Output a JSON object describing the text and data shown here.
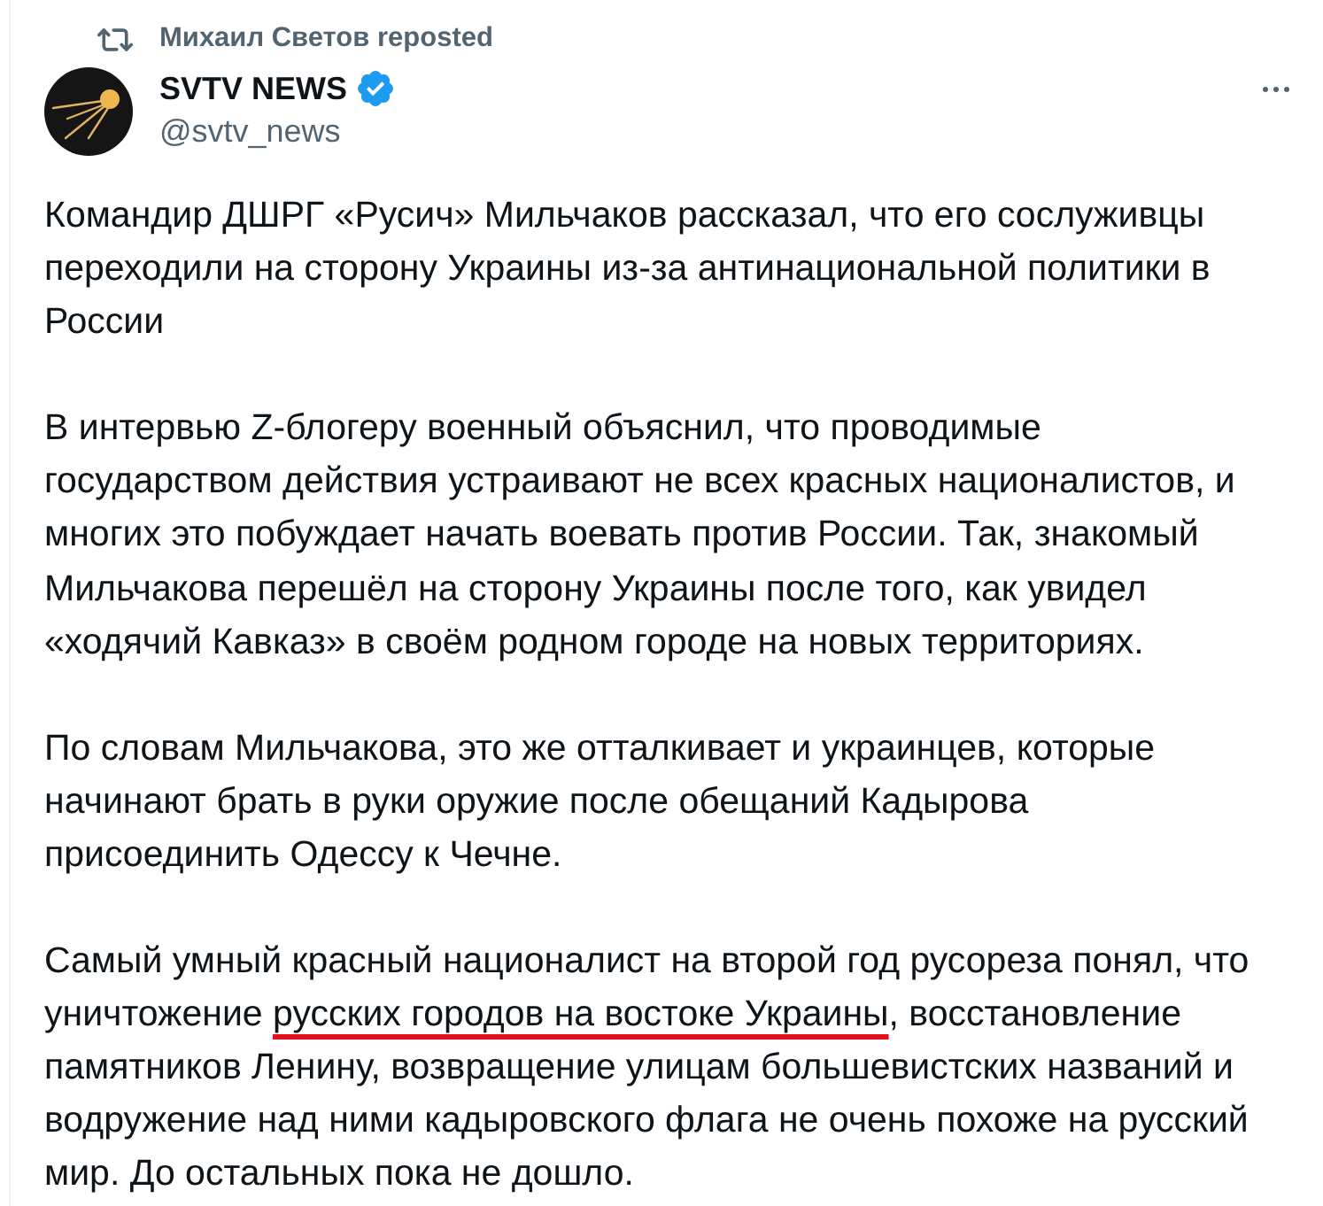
{
  "repost": {
    "text": "Михаил Светов reposted"
  },
  "author": {
    "name": "SVTV NEWS",
    "verified": true,
    "handle": "@svtv_news"
  },
  "paragraphs": [
    {
      "segments": [
        {
          "kind": "plain",
          "text": "Командир ДШРГ «Русич» Мильчаков рассказал, что его сослуживцы\nпереходили на сторону Украины из-за антинациональной политики в\nРоссии"
        }
      ]
    },
    {
      "segments": [
        {
          "kind": "plain",
          "text": "В интервью Z-блогеру военный объяснил, что проводимые\nгосударством действия устраивают не всех красных националистов, и\nмногих это побуждает начать воевать против России. Так, знакомый\nМильчакова перешёл на сторону Украины после того, как увидел\n«ходячий Кавказ» в своём родном городе на новых территориях."
        }
      ]
    },
    {
      "segments": [
        {
          "kind": "plain",
          "text": "По словам Мильчакова, это же отталкивает и украинцев, которые\nначинают брать в руки оружие после обещаний Кадырова\nприсоединить Одессу к Чечне."
        }
      ]
    },
    {
      "segments": [
        {
          "kind": "plain",
          "text": "Самый умный красный националист на второй год русореза понял, что\nуничтожение "
        },
        {
          "kind": "underlined",
          "text": "русских городов на востоке Украины"
        },
        {
          "kind": "plain",
          "text": ", восстановление\nпамятников Ленину, возвращение улицам большевистских названий и\nводружение над ними кадыровского флага не очень похоже на русский\nмир. До остальных пока не дошло."
        }
      ]
    }
  ]
}
